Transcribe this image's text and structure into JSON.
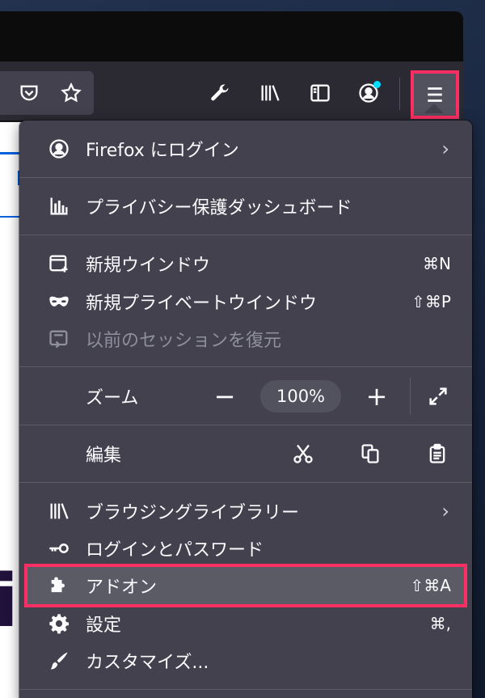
{
  "menu": {
    "account": {
      "label": "Firefox にログイン",
      "icon": "account-icon"
    },
    "privacy": {
      "label": "プライバシー保護ダッシュボード",
      "icon": "dashboard-chart-icon"
    },
    "new_window": {
      "label": "新規ウインドウ",
      "shortcut": "⌘N",
      "icon": "new-window-icon"
    },
    "new_private": {
      "label": "新規プライベートウインドウ",
      "shortcut": "⇧⌘P",
      "icon": "private-mask-icon"
    },
    "restore": {
      "label": "以前のセッションを復元",
      "icon": "restore-session-icon"
    },
    "zoom": {
      "label": "ズーム",
      "minus": "−",
      "value": "100%",
      "plus": "+"
    },
    "edit": {
      "label": "編集"
    },
    "library": {
      "label": "ブラウジングライブラリー",
      "icon": "library-icon"
    },
    "logins": {
      "label": "ログインとパスワード",
      "icon": "key-icon"
    },
    "addons": {
      "label": "アドオン",
      "shortcut": "⇧⌘A",
      "icon": "puzzle-icon"
    },
    "settings": {
      "label": "設定",
      "shortcut": "⌘,",
      "icon": "gear-icon"
    },
    "customize": {
      "label": "カスタマイズ...",
      "icon": "brush-icon"
    }
  },
  "content": {
    "glyph": "i"
  },
  "colors": {
    "highlight": "#ff2e63",
    "panel_bg": "#42414d",
    "toolbar_bg": "#2b2a33",
    "text": "#fbfbfe"
  }
}
